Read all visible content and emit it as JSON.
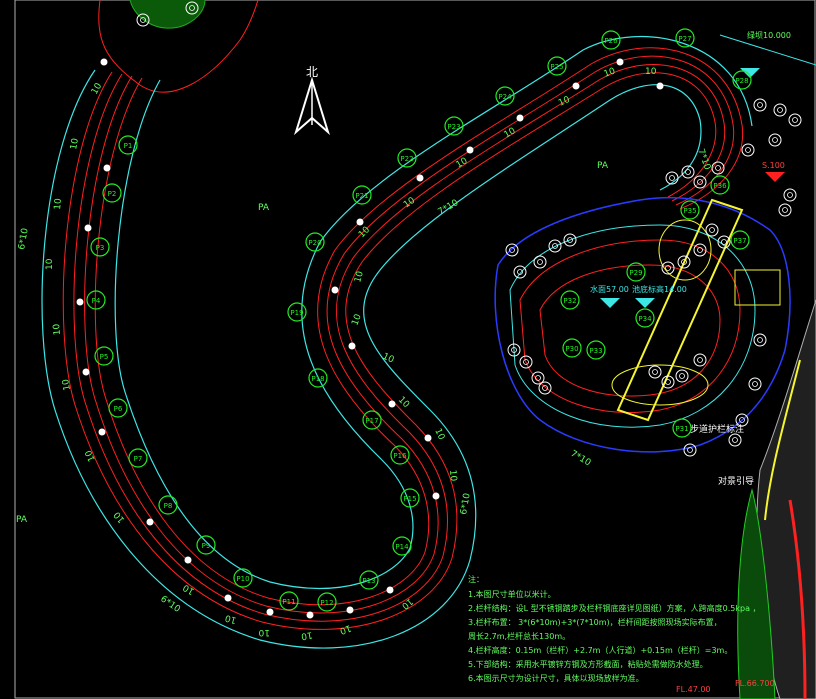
{
  "drawing": {
    "north_label": "北",
    "area_labels": [
      "PA",
      "PA",
      "PA"
    ],
    "elevation_top": "绿坝10.000",
    "elevation_right": "S.100",
    "elevation_center_a": "水面57.00",
    "elevation_center_b": "池底标高14.00",
    "label_left_track": "6*10",
    "label_bottom_track": "6*10",
    "label_right_track": "6*10",
    "label_mid_track": "7*10",
    "label_inner_track": "7*10",
    "label_lower_track": "7*10",
    "segment_label": "10",
    "road_label_a": "步道护栏标注",
    "road_label_b": "对景引导",
    "fl_label_a": "FL.47.00",
    "fl_label_b": "FL.66.700"
  },
  "markers": {
    "left": [
      "P1",
      "P2",
      "P3",
      "P4",
      "P5",
      "P6",
      "P7",
      "P8",
      "P9"
    ],
    "bottom": [
      "P10",
      "P11",
      "P12",
      "P13",
      "P14",
      "P15",
      "P16",
      "P17",
      "P18"
    ],
    "inner": [
      "P19",
      "P20",
      "P21",
      "P22",
      "P23",
      "P24",
      "P25",
      "P26",
      "P27",
      "P28"
    ],
    "right": [
      "P29",
      "P30",
      "P31",
      "P32",
      "P33",
      "P34",
      "P35",
      "P36",
      "P37"
    ]
  },
  "notes": {
    "title": "注：",
    "lines": [
      "1.本图尺寸单位以米计。",
      "2.栏杆结构：设L 型不锈钢踏步及栏杆钢底座详见图纸）方案，人跨高度0.5kpa ，",
      "3.栏杆布置： 3*(6*10m)+3*(7*10m)，栏杆间距按照现场实际布置，",
      "周长2.7m,栏杆总长130m。",
      "4.栏杆高度：0.15m（栏杆）+2.7m（人行道）+0.15m（栏杆）=3m。",
      "5.下部结构：采用水平镀锌方钢及方形截面，粘贴处需做防水处理。",
      "6.本图示尺寸为设计尺寸，具体以现场放样为准。"
    ]
  }
}
